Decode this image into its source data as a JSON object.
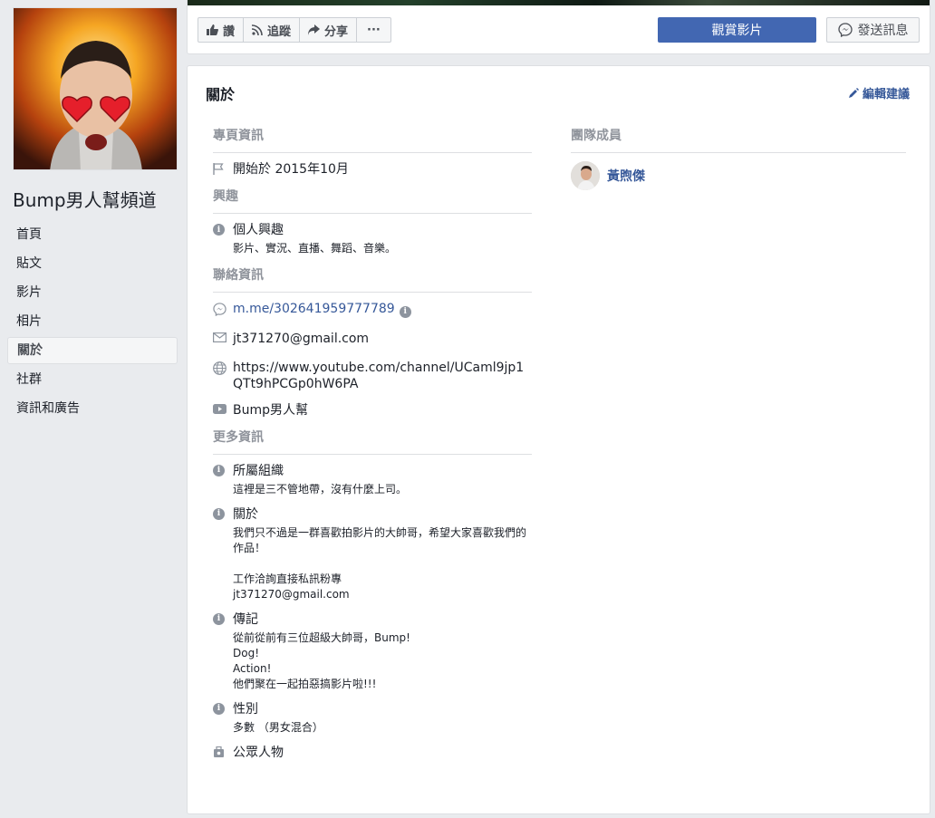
{
  "page": {
    "name": "Bump男人幫頻道"
  },
  "nav": {
    "items": [
      {
        "label": "首頁"
      },
      {
        "label": "貼文"
      },
      {
        "label": "影片"
      },
      {
        "label": "相片"
      },
      {
        "label": "關於"
      },
      {
        "label": "社群"
      },
      {
        "label": "資訊和廣告"
      }
    ]
  },
  "toolbar": {
    "like": "讚",
    "follow": "追蹤",
    "share": "分享",
    "more": "···",
    "watch_video": "觀賞影片",
    "send_message": "發送訊息"
  },
  "about": {
    "title": "關於",
    "edit_suggestion": "編輯建議",
    "page_info": {
      "heading": "專頁資訊",
      "started": "開始於 2015年10月"
    },
    "interests": {
      "heading": "興趣",
      "label": "個人興趣",
      "value": "影片、實況、直播、舞蹈、音樂。"
    },
    "contact": {
      "heading": "聯絡資訊",
      "messenger": "m.me/302641959777789",
      "email": "jt371270@gmail.com",
      "website": "https://www.youtube.com/channel/UCaml9jp1QTt9hPCGp0hW6PA",
      "youtube": "Bump男人幫"
    },
    "more_info": {
      "heading": "更多資訊",
      "org_label": "所屬組織",
      "org_value": "這裡是三不管地帶，沒有什麼上司。",
      "about_label": "關於",
      "about_line1": "我們只不過是一群喜歡拍影片的大帥哥，希望大家喜歡我們的作品！",
      "about_line2": "工作洽詢直接私訊粉專",
      "about_line3": "jt371270@gmail.com",
      "bio_label": "傳記",
      "bio_line1": "從前從前有三位超級大帥哥，Bump!",
      "bio_line2": "Dog!",
      "bio_line3": "Action!",
      "bio_line4": "他們聚在一起拍惡搞影片啦!!!",
      "gender_label": "性別",
      "gender_value": "多數 （男女混合）",
      "category": "公眾人物"
    },
    "team": {
      "heading": "團隊成員",
      "member_name": "黃煦傑"
    }
  },
  "colors": {
    "brand_blue": "#4267b2",
    "link": "#365899",
    "muted": "#90949c"
  }
}
